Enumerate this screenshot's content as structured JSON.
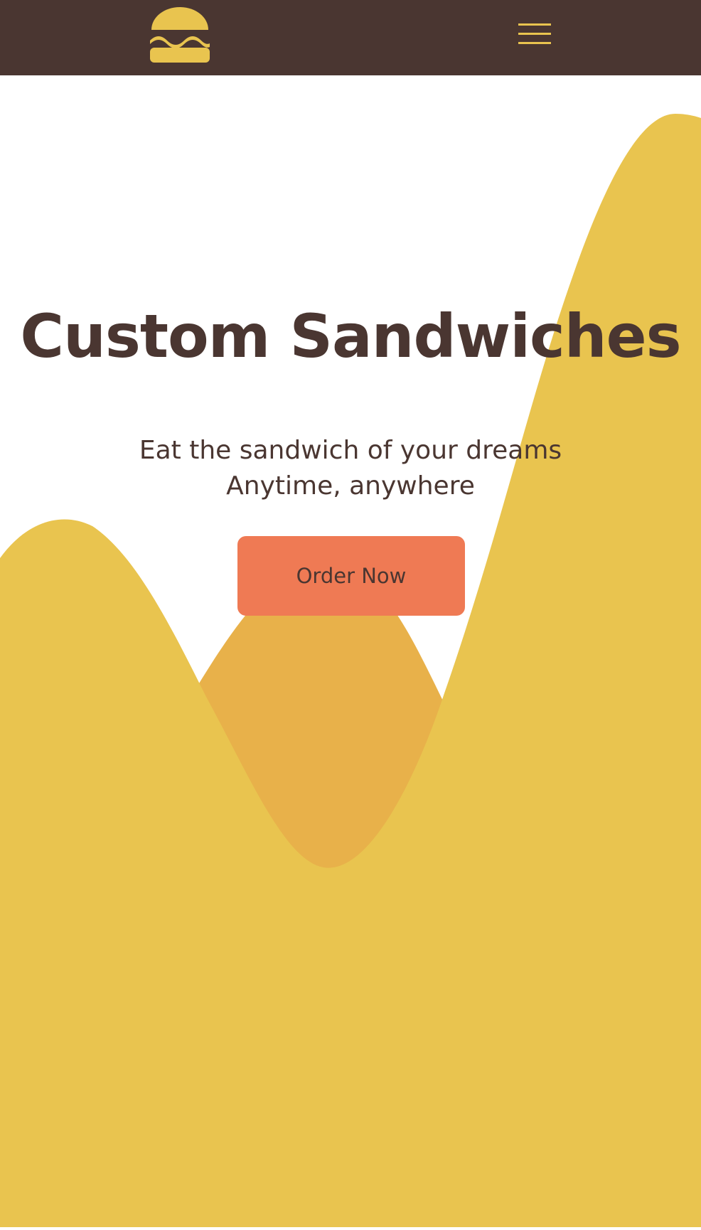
{
  "header": {
    "logo_icon": "burger-logo-icon",
    "menu_icon": "hamburger-menu-icon"
  },
  "hero": {
    "title": "Custom Sandwiches",
    "subtitle_line1": "Eat the sandwich of your dreams",
    "subtitle_line2": "Anytime, anywhere",
    "cta_label": "Order Now"
  },
  "colors": {
    "header_bg": "#4a3631",
    "text_dark": "#4a3631",
    "accent_yellow": "#e9c44f",
    "accent_orange": "#e8b14a",
    "button": "#ef7a54",
    "page_bg": "#ffffff"
  }
}
